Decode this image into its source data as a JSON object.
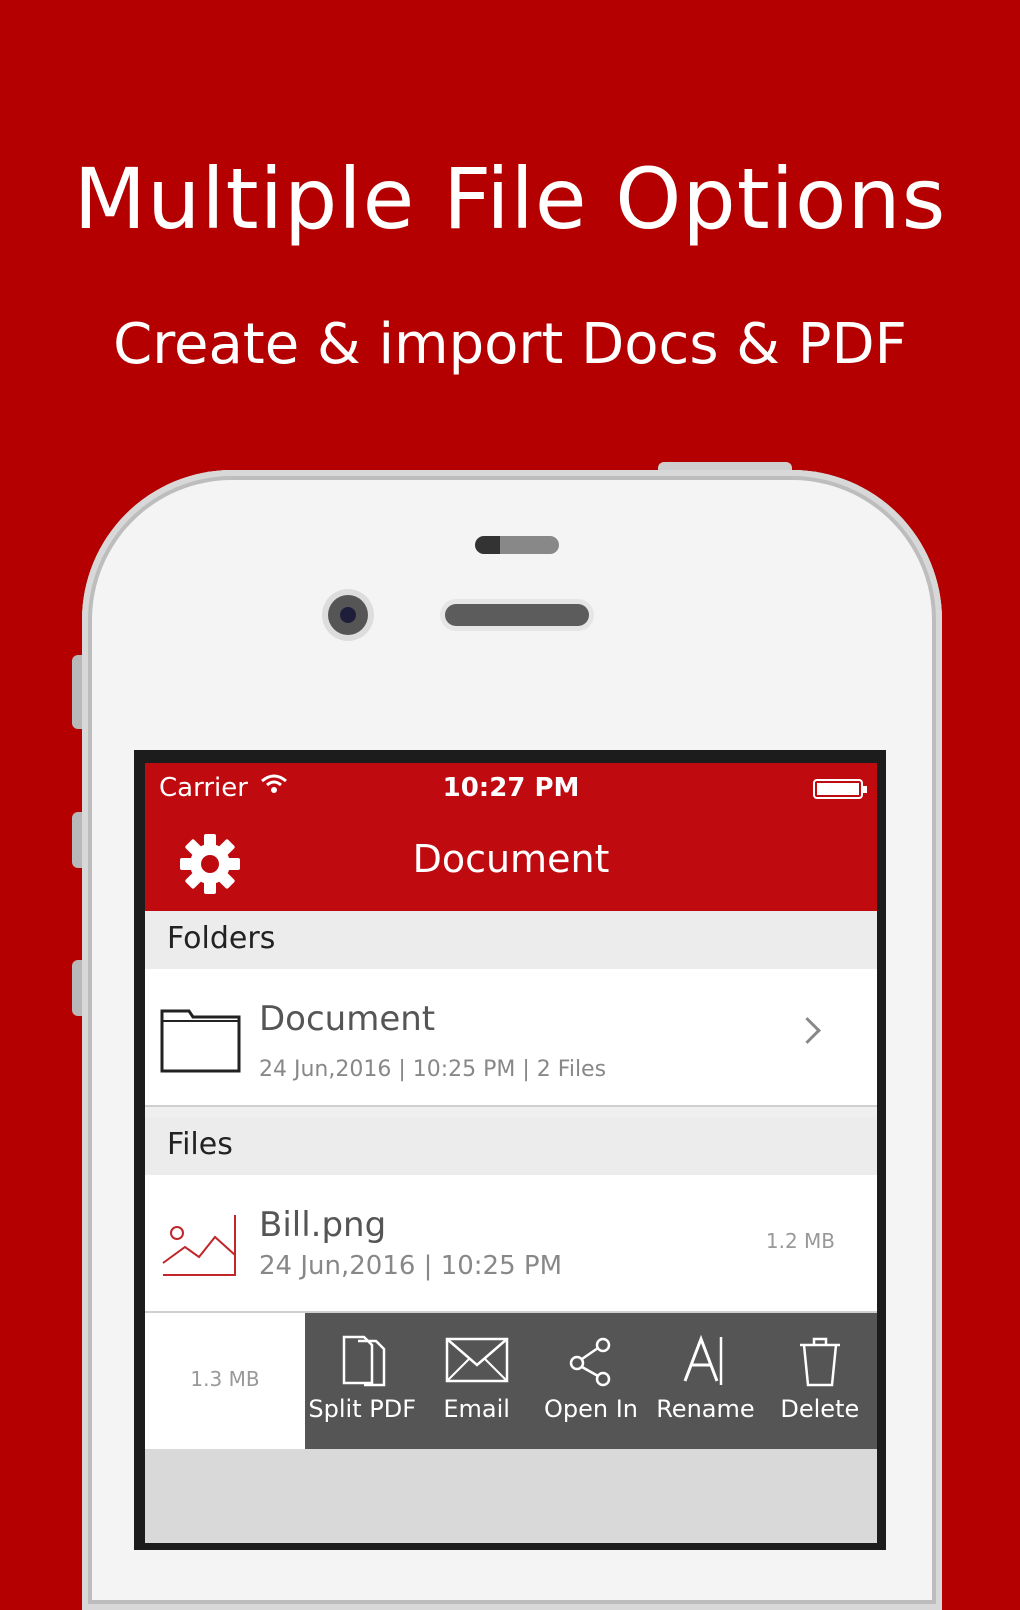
{
  "promo": {
    "headline": "Multiple File Options",
    "subline": "Create & import Docs & PDF",
    "background_color": "#b40000"
  },
  "status_bar": {
    "carrier": "Carrier",
    "wifi_icon": "wifi-icon",
    "time": "10:27 PM",
    "battery_icon": "battery-icon"
  },
  "navbar": {
    "title": "Document",
    "settings_icon": "gear-icon",
    "color": "#bf0a10"
  },
  "folders_section": {
    "header": "Folders",
    "items": [
      {
        "name": "Document",
        "meta": "24 Jun,2016 | 10:25 PM | 2 Files",
        "icon": "folder-icon"
      }
    ]
  },
  "files_section": {
    "header": "Files",
    "items": [
      {
        "name": "Bill.png",
        "meta": "24 Jun,2016 | 10:25 PM",
        "size": "1.2 MB",
        "icon": "image-icon"
      }
    ],
    "swiped_item_size": "1.3 MB"
  },
  "swipe_actions": [
    {
      "label": "Split PDF",
      "icon": "split-pdf-icon"
    },
    {
      "label": "Email",
      "icon": "email-icon"
    },
    {
      "label": "Open In",
      "icon": "share-icon"
    },
    {
      "label": "Rename",
      "icon": "rename-icon"
    },
    {
      "label": "Delete",
      "icon": "trash-icon"
    }
  ]
}
